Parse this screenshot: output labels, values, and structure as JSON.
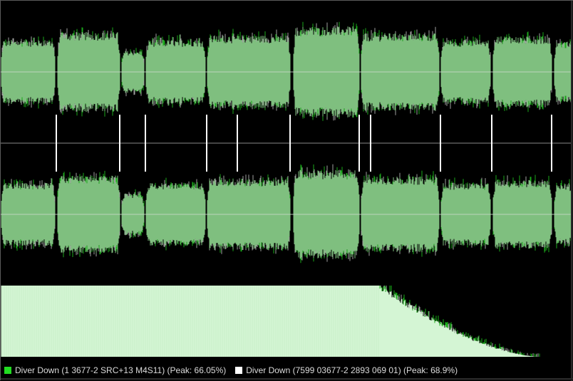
{
  "colors": {
    "background": "#000000",
    "wave_fill": "#7fbf7f",
    "wave_edge_green": "#1aa81a",
    "wave_edge_gray": "#a0a0a0",
    "center_line": "#c8d8c8",
    "marker_line": "#ffffff",
    "spectrum_fill": "#d4f5d4",
    "spectrum_edge_green": "#18b018",
    "legend_green": "#22dd22",
    "legend_white": "#ffffff"
  },
  "legend": {
    "series1": "Diver Down (1 3677-2 SRC+13 M4S11) (Peak: 66.05%)",
    "series2": "Diver Down (7599 03677-2 2893 069 01) (Peak: 68.9%)"
  },
  "segments": [
    {
      "start": 0.0,
      "end": 0.095,
      "level": 0.58
    },
    {
      "start": 0.098,
      "end": 0.208,
      "level": 0.72
    },
    {
      "start": 0.21,
      "end": 0.25,
      "level": 0.38
    },
    {
      "start": 0.253,
      "end": 0.357,
      "level": 0.58
    },
    {
      "start": 0.36,
      "end": 0.505,
      "level": 0.66
    },
    {
      "start": 0.51,
      "end": 0.625,
      "level": 0.82
    },
    {
      "start": 0.628,
      "end": 0.765,
      "level": 0.7
    },
    {
      "start": 0.768,
      "end": 0.855,
      "level": 0.58
    },
    {
      "start": 0.858,
      "end": 0.962,
      "level": 0.64
    },
    {
      "start": 0.965,
      "end": 1.0,
      "level": 0.55
    }
  ],
  "markers": [
    0.097,
    0.208,
    0.252,
    0.36,
    0.413,
    0.505,
    0.625,
    0.645,
    0.767,
    0.857,
    0.962
  ],
  "spectrum": {
    "flat_until": 0.66,
    "end": 0.94
  }
}
